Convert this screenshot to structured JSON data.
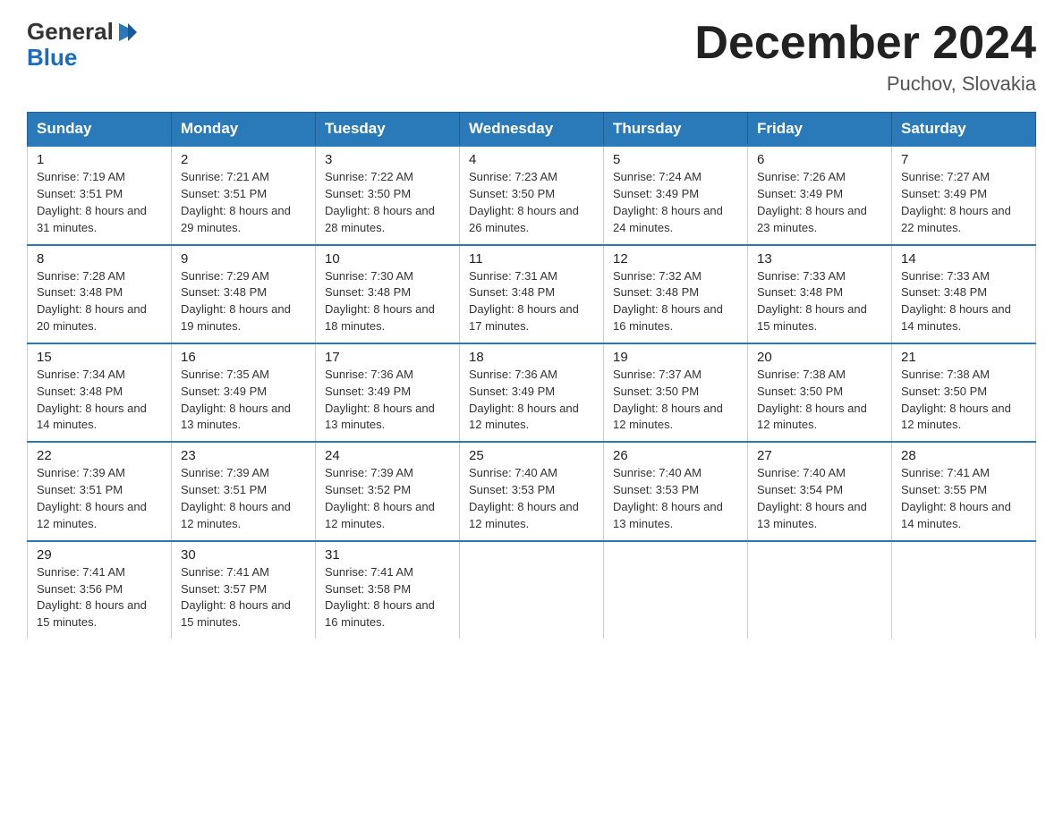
{
  "header": {
    "logo": {
      "text_general": "General",
      "logo_triangle": "▶",
      "text_blue": "Blue"
    },
    "title": "December 2024",
    "subtitle": "Puchov, Slovakia"
  },
  "days_of_week": [
    "Sunday",
    "Monday",
    "Tuesday",
    "Wednesday",
    "Thursday",
    "Friday",
    "Saturday"
  ],
  "weeks": [
    {
      "days": [
        {
          "num": "1",
          "sunrise": "7:19 AM",
          "sunset": "3:51 PM",
          "daylight": "8 hours and 31 minutes."
        },
        {
          "num": "2",
          "sunrise": "7:21 AM",
          "sunset": "3:51 PM",
          "daylight": "8 hours and 29 minutes."
        },
        {
          "num": "3",
          "sunrise": "7:22 AM",
          "sunset": "3:50 PM",
          "daylight": "8 hours and 28 minutes."
        },
        {
          "num": "4",
          "sunrise": "7:23 AM",
          "sunset": "3:50 PM",
          "daylight": "8 hours and 26 minutes."
        },
        {
          "num": "5",
          "sunrise": "7:24 AM",
          "sunset": "3:49 PM",
          "daylight": "8 hours and 24 minutes."
        },
        {
          "num": "6",
          "sunrise": "7:26 AM",
          "sunset": "3:49 PM",
          "daylight": "8 hours and 23 minutes."
        },
        {
          "num": "7",
          "sunrise": "7:27 AM",
          "sunset": "3:49 PM",
          "daylight": "8 hours and 22 minutes."
        }
      ]
    },
    {
      "days": [
        {
          "num": "8",
          "sunrise": "7:28 AM",
          "sunset": "3:48 PM",
          "daylight": "8 hours and 20 minutes."
        },
        {
          "num": "9",
          "sunrise": "7:29 AM",
          "sunset": "3:48 PM",
          "daylight": "8 hours and 19 minutes."
        },
        {
          "num": "10",
          "sunrise": "7:30 AM",
          "sunset": "3:48 PM",
          "daylight": "8 hours and 18 minutes."
        },
        {
          "num": "11",
          "sunrise": "7:31 AM",
          "sunset": "3:48 PM",
          "daylight": "8 hours and 17 minutes."
        },
        {
          "num": "12",
          "sunrise": "7:32 AM",
          "sunset": "3:48 PM",
          "daylight": "8 hours and 16 minutes."
        },
        {
          "num": "13",
          "sunrise": "7:33 AM",
          "sunset": "3:48 PM",
          "daylight": "8 hours and 15 minutes."
        },
        {
          "num": "14",
          "sunrise": "7:33 AM",
          "sunset": "3:48 PM",
          "daylight": "8 hours and 14 minutes."
        }
      ]
    },
    {
      "days": [
        {
          "num": "15",
          "sunrise": "7:34 AM",
          "sunset": "3:48 PM",
          "daylight": "8 hours and 14 minutes."
        },
        {
          "num": "16",
          "sunrise": "7:35 AM",
          "sunset": "3:49 PM",
          "daylight": "8 hours and 13 minutes."
        },
        {
          "num": "17",
          "sunrise": "7:36 AM",
          "sunset": "3:49 PM",
          "daylight": "8 hours and 13 minutes."
        },
        {
          "num": "18",
          "sunrise": "7:36 AM",
          "sunset": "3:49 PM",
          "daylight": "8 hours and 12 minutes."
        },
        {
          "num": "19",
          "sunrise": "7:37 AM",
          "sunset": "3:50 PM",
          "daylight": "8 hours and 12 minutes."
        },
        {
          "num": "20",
          "sunrise": "7:38 AM",
          "sunset": "3:50 PM",
          "daylight": "8 hours and 12 minutes."
        },
        {
          "num": "21",
          "sunrise": "7:38 AM",
          "sunset": "3:50 PM",
          "daylight": "8 hours and 12 minutes."
        }
      ]
    },
    {
      "days": [
        {
          "num": "22",
          "sunrise": "7:39 AM",
          "sunset": "3:51 PM",
          "daylight": "8 hours and 12 minutes."
        },
        {
          "num": "23",
          "sunrise": "7:39 AM",
          "sunset": "3:51 PM",
          "daylight": "8 hours and 12 minutes."
        },
        {
          "num": "24",
          "sunrise": "7:39 AM",
          "sunset": "3:52 PM",
          "daylight": "8 hours and 12 minutes."
        },
        {
          "num": "25",
          "sunrise": "7:40 AM",
          "sunset": "3:53 PM",
          "daylight": "8 hours and 12 minutes."
        },
        {
          "num": "26",
          "sunrise": "7:40 AM",
          "sunset": "3:53 PM",
          "daylight": "8 hours and 13 minutes."
        },
        {
          "num": "27",
          "sunrise": "7:40 AM",
          "sunset": "3:54 PM",
          "daylight": "8 hours and 13 minutes."
        },
        {
          "num": "28",
          "sunrise": "7:41 AM",
          "sunset": "3:55 PM",
          "daylight": "8 hours and 14 minutes."
        }
      ]
    },
    {
      "days": [
        {
          "num": "29",
          "sunrise": "7:41 AM",
          "sunset": "3:56 PM",
          "daylight": "8 hours and 15 minutes."
        },
        {
          "num": "30",
          "sunrise": "7:41 AM",
          "sunset": "3:57 PM",
          "daylight": "8 hours and 15 minutes."
        },
        {
          "num": "31",
          "sunrise": "7:41 AM",
          "sunset": "3:58 PM",
          "daylight": "8 hours and 16 minutes."
        },
        null,
        null,
        null,
        null
      ]
    }
  ]
}
